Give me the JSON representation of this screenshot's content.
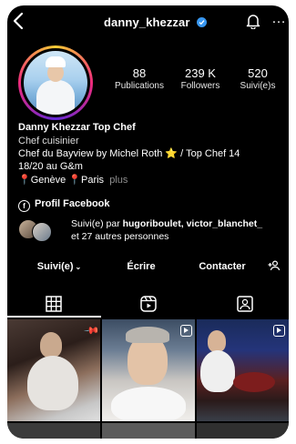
{
  "header": {
    "username": "danny_khezzar",
    "back_icon": "chevron-left-icon",
    "verified_icon": "verified-badge-icon",
    "bell_icon": "bell-icon",
    "more_icon": "more-horizontal-icon",
    "more_glyph": "…"
  },
  "profile": {
    "avatar_icon": "avatar",
    "stats": [
      {
        "value": "88",
        "label": "Publications"
      },
      {
        "value": "239 K",
        "label": "Followers"
      },
      {
        "value": "520",
        "label": "Suivi(e)s"
      }
    ],
    "name": "Danny Khezzar Top Chef",
    "category": "Chef cuisinier",
    "bio_line1": "Chef du Bayview by Michel Roth",
    "bio_line1_star": "⭐",
    "bio_line1_rest": " /  Top Chef 14",
    "bio_line2": "18/20 au G&m",
    "loc1": "Genève",
    "loc2": "Paris",
    "more_link": "plus",
    "facebook_icon": "facebook-icon",
    "facebook_letter": "f",
    "facebook_label": "Profil Facebook",
    "followed_by_prefix": "Suivi(e) par ",
    "followed_by_names": "hugoriboulet, victor_blanchet_",
    "followed_by_suffix": "et 27 autres personnes"
  },
  "actions": {
    "follow_label": "Suivi(e)",
    "follow_chevron": "⌄",
    "message_label": "Écrire",
    "contact_label": "Contacter",
    "add_person_icon": "add-person-icon"
  },
  "tabs": [
    {
      "icon": "grid-icon"
    },
    {
      "icon": "reels-icon"
    },
    {
      "icon": "tagged-icon"
    }
  ],
  "colors": {
    "background": "#000000",
    "verified": "#3897f0",
    "text_muted": "#8e8e8e"
  }
}
